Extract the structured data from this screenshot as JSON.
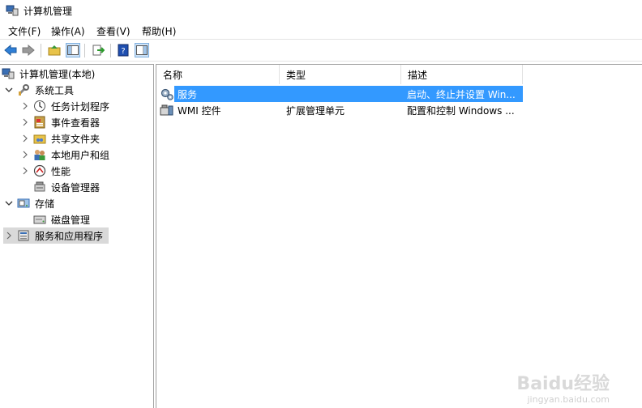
{
  "window": {
    "title": "计算机管理"
  },
  "menu": [
    "文件(F)",
    "操作(A)",
    "查看(V)",
    "帮助(H)"
  ],
  "tree": {
    "root": "计算机管理(本地)",
    "system_tools": "系统工具",
    "task_scheduler": "任务计划程序",
    "event_viewer": "事件查看器",
    "shared_folders": "共享文件夹",
    "local_users": "本地用户和组",
    "performance": "性能",
    "device_manager": "设备管理器",
    "storage": "存储",
    "disk_management": "磁盘管理",
    "services_apps": "服务和应用程序"
  },
  "list": {
    "columns": [
      "名称",
      "类型",
      "描述"
    ],
    "rows": [
      {
        "name": "服务",
        "type": "",
        "desc": "启动、终止并设置 Win..."
      },
      {
        "name": "WMI 控件",
        "type": "扩展管理单元",
        "desc": "配置和控制 Windows ..."
      }
    ]
  },
  "watermark": {
    "logo": "Baidu经验",
    "url": "jingyan.baidu.com"
  },
  "colors": {
    "selection": "#3399ff",
    "tree_selected": "#d9d9d9"
  }
}
